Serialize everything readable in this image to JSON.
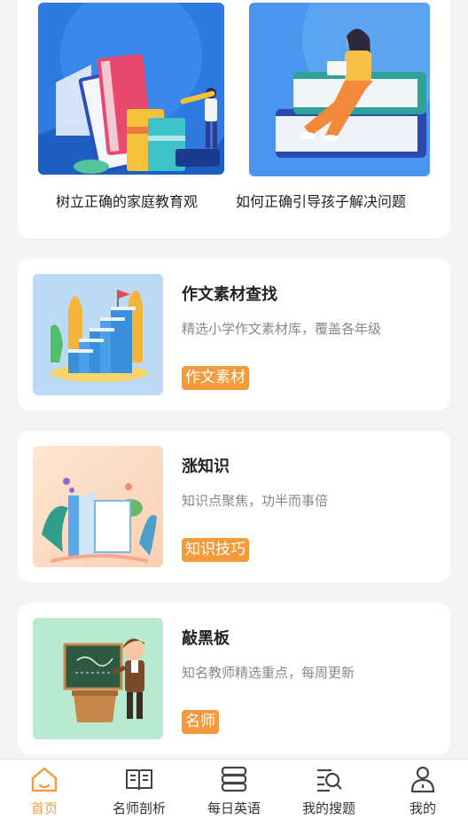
{
  "features": [
    {
      "title": "树立正确的家庭教育观"
    },
    {
      "title": "如何正确引导孩子解决问题"
    }
  ],
  "cards": [
    {
      "title": "作文素材查找",
      "desc": "精选小学作文素材库，覆盖各年级",
      "tag": "作文素材"
    },
    {
      "title": "涨知识",
      "desc": "知识点聚焦，功半而事倍",
      "tag": "知识技巧"
    },
    {
      "title": "敲黑板",
      "desc": "知名教师精选重点，每周更新",
      "tag": "名师"
    }
  ],
  "tabs": [
    {
      "label": "首页",
      "icon": "home-icon",
      "active": true
    },
    {
      "label": "名师剖析",
      "icon": "book-icon",
      "active": false
    },
    {
      "label": "每日英语",
      "icon": "stack-icon",
      "active": false
    },
    {
      "label": "我的搜题",
      "icon": "search-list-icon",
      "active": false
    },
    {
      "label": "我的",
      "icon": "user-icon",
      "active": false
    }
  ],
  "colors": {
    "accent": "#f59a3c",
    "background": "#f4f4f4"
  }
}
